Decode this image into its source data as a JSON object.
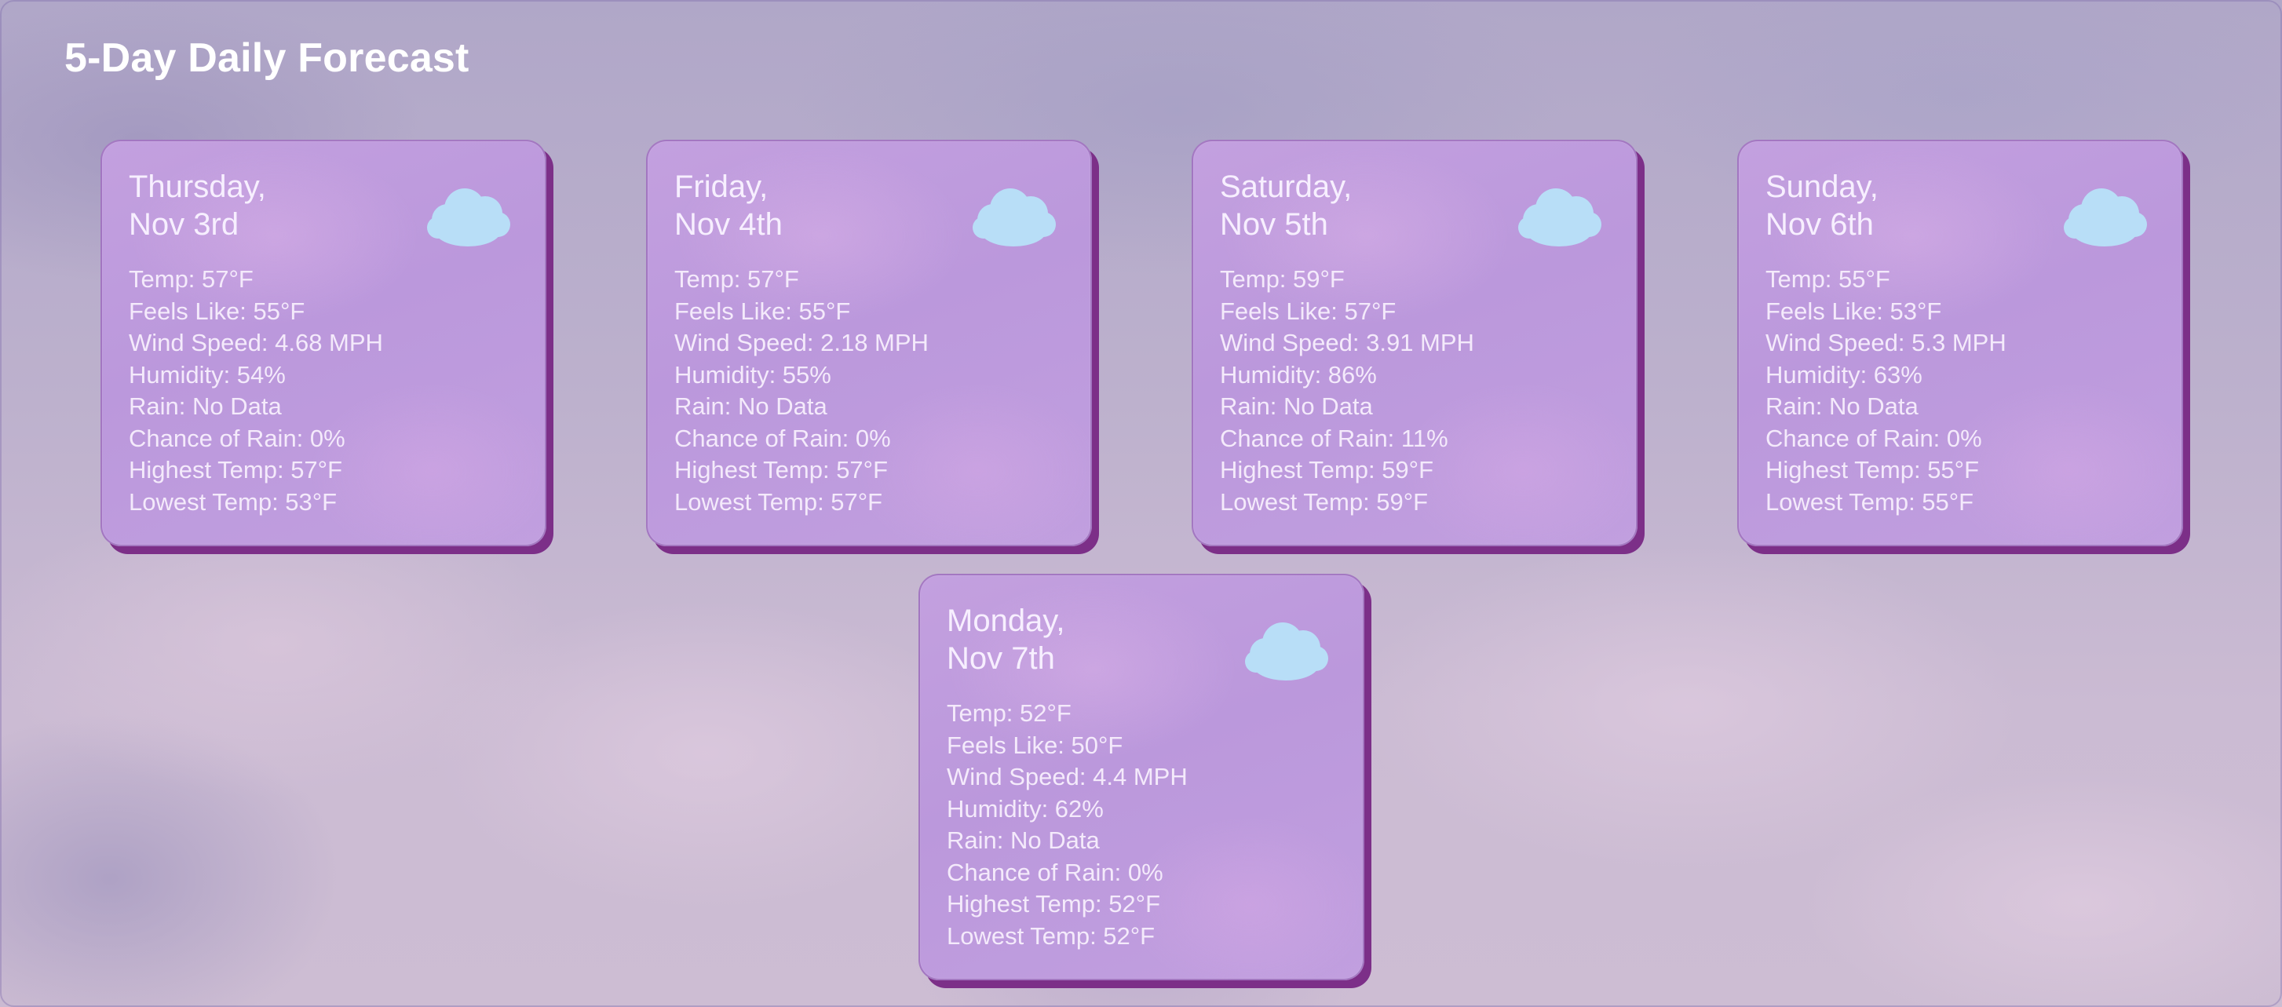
{
  "page": {
    "title": "5-Day Daily Forecast"
  },
  "forecast": [
    {
      "day": "Thursday,",
      "date": "Nov 3rd",
      "icon": "cloud-icon",
      "temp": "Temp: 57°F",
      "feels_like": "Feels Like: 55°F",
      "wind_speed": "Wind Speed: 4.68 MPH",
      "humidity": "Humidity: 54%",
      "rain": "Rain: No Data",
      "chance_of_rain": "Chance of Rain: 0%",
      "highest_temp": "Highest Temp: 57°F",
      "lowest_temp": "Lowest Temp: 53°F"
    },
    {
      "day": "Friday,",
      "date": "Nov 4th",
      "icon": "cloud-icon",
      "temp": "Temp: 57°F",
      "feels_like": "Feels Like: 55°F",
      "wind_speed": "Wind Speed: 2.18 MPH",
      "humidity": "Humidity: 55%",
      "rain": "Rain: No Data",
      "chance_of_rain": "Chance of Rain: 0%",
      "highest_temp": "Highest Temp: 57°F",
      "lowest_temp": "Lowest Temp: 57°F"
    },
    {
      "day": "Saturday,",
      "date": "Nov 5th",
      "icon": "cloud-icon",
      "temp": "Temp: 59°F",
      "feels_like": "Feels Like: 57°F",
      "wind_speed": "Wind Speed: 3.91 MPH",
      "humidity": "Humidity: 86%",
      "rain": "Rain: No Data",
      "chance_of_rain": "Chance of Rain: 11%",
      "highest_temp": "Highest Temp: 59°F",
      "lowest_temp": "Lowest Temp: 59°F"
    },
    {
      "day": "Sunday,",
      "date": "Nov 6th",
      "icon": "cloud-icon",
      "temp": "Temp: 55°F",
      "feels_like": "Feels Like: 53°F",
      "wind_speed": "Wind Speed: 5.3 MPH",
      "humidity": "Humidity: 63%",
      "rain": "Rain: No Data",
      "chance_of_rain": "Chance of Rain: 0%",
      "highest_temp": "Highest Temp: 55°F",
      "lowest_temp": "Lowest Temp: 55°F"
    },
    {
      "day": "Monday,",
      "date": "Nov 7th",
      "icon": "cloud-icon",
      "temp": "Temp: 52°F",
      "feels_like": "Feels Like: 50°F",
      "wind_speed": "Wind Speed: 4.4 MPH",
      "humidity": "Humidity: 62%",
      "rain": "Rain: No Data",
      "chance_of_rain": "Chance of Rain: 0%",
      "highest_temp": "Highest Temp: 52°F",
      "lowest_temp": "Lowest Temp: 52°F"
    }
  ],
  "colors": {
    "card_background": "#bf9cde",
    "card_shadow": "#7c2f88",
    "cloud": "#b8def7",
    "title_text": "#ffffff"
  }
}
